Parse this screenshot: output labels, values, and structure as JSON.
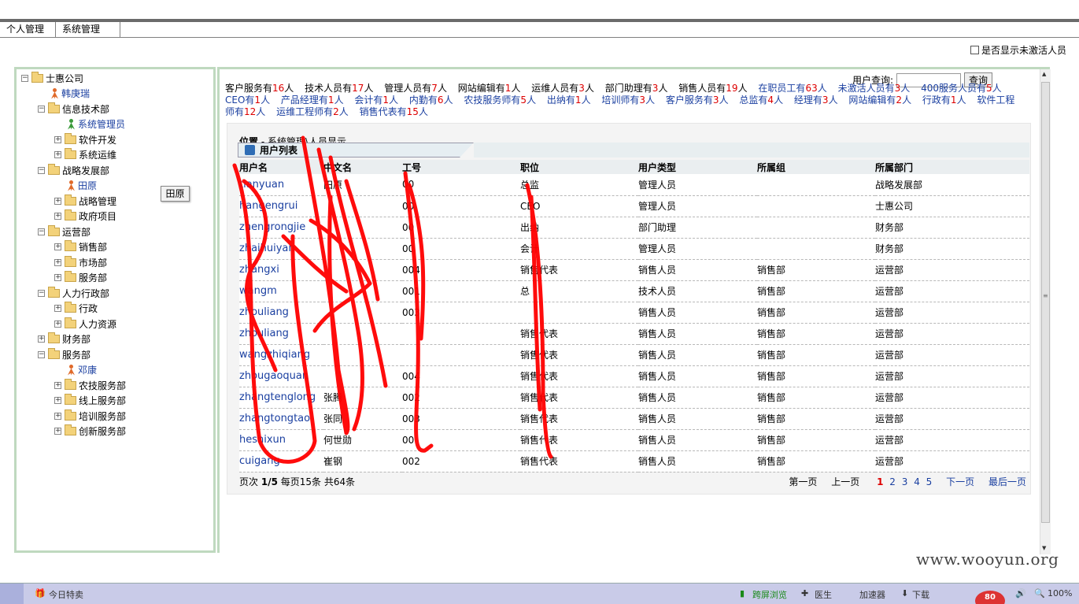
{
  "tabs": [
    "个人管理",
    "系统管理"
  ],
  "show_inactive_label": "是否显示未激活人员",
  "tree": [
    {
      "type": "root",
      "label": "士惠公司",
      "toggle": "⊟"
    },
    {
      "type": "person",
      "label": "韩庚瑞"
    },
    {
      "type": "folder",
      "label": "信息技术部",
      "toggle": "⊟"
    },
    {
      "type": "person-green",
      "label": "系统管理员"
    },
    {
      "type": "folder",
      "label": "软件开发",
      "toggle": "⊞"
    },
    {
      "type": "folder",
      "label": "系统运维",
      "toggle": "⊞"
    },
    {
      "type": "folder",
      "label": "战略发展部",
      "toggle": "⊟"
    },
    {
      "type": "person",
      "label": "田原"
    },
    {
      "type": "folder",
      "label": "战略管理",
      "toggle": "⊞"
    },
    {
      "type": "folder",
      "label": "政府项目",
      "toggle": "⊞"
    },
    {
      "type": "folder",
      "label": "运营部",
      "toggle": "⊟"
    },
    {
      "type": "folder",
      "label": "销售部",
      "toggle": "⊞"
    },
    {
      "type": "folder",
      "label": "市场部",
      "toggle": "⊞"
    },
    {
      "type": "folder",
      "label": "服务部",
      "toggle": "⊞"
    },
    {
      "type": "folder",
      "label": "人力行政部",
      "toggle": "⊟"
    },
    {
      "type": "folder",
      "label": "行政",
      "toggle": "⊞"
    },
    {
      "type": "folder",
      "label": "人力资源",
      "toggle": "⊞"
    },
    {
      "type": "folder",
      "label": "财务部",
      "toggle": "⊞"
    },
    {
      "type": "folder",
      "label": "服务部",
      "toggle": "⊟"
    },
    {
      "type": "person",
      "label": "邓康"
    },
    {
      "type": "folder",
      "label": "农技服务部",
      "toggle": "⊞"
    },
    {
      "type": "folder",
      "label": "线上服务部",
      "toggle": "⊞"
    },
    {
      "type": "folder",
      "label": "培训服务部",
      "toggle": "⊞"
    },
    {
      "type": "folder",
      "label": "创新服务部",
      "toggle": "⊞"
    }
  ],
  "tooltip": "田原",
  "query": {
    "label": "用户查询:",
    "button": "查询"
  },
  "stats": [
    {
      "pre": "客户服务有",
      "num": "16",
      "post": "人",
      "link": false
    },
    {
      "pre": "技术人员有",
      "num": "17",
      "post": "人",
      "link": false
    },
    {
      "pre": "管理人员有",
      "num": "7",
      "post": "人",
      "link": false
    },
    {
      "pre": "网站编辑有",
      "num": "1",
      "post": "人",
      "link": false
    },
    {
      "pre": "运维人员有",
      "num": "3",
      "post": "人",
      "link": false
    },
    {
      "pre": "部门助理有",
      "num": "3",
      "post": "人",
      "link": false
    },
    {
      "pre": "销售人员有",
      "num": "19",
      "post": "人",
      "link": false
    },
    {
      "pre": "在职员工有",
      "num": "63",
      "post": "人",
      "link": true
    },
    {
      "pre": "未激活人员有",
      "num": "3",
      "post": "人",
      "link": true
    },
    {
      "pre": "400服务人员有",
      "num": "5",
      "post": "人",
      "link": true
    },
    {
      "pre": "CEO有",
      "num": "1",
      "post": "人",
      "link": true
    },
    {
      "pre": "产品经理有",
      "num": "1",
      "post": "人",
      "link": true
    },
    {
      "pre": "会计有",
      "num": "1",
      "post": "人",
      "link": true
    },
    {
      "pre": "内勤有",
      "num": "6",
      "post": "人",
      "link": true
    },
    {
      "pre": "农技服务师有",
      "num": "5",
      "post": "人",
      "link": true
    },
    {
      "pre": "出纳有",
      "num": "1",
      "post": "人",
      "link": true
    },
    {
      "pre": "培训师有",
      "num": "3",
      "post": "人",
      "link": true
    },
    {
      "pre": "客户服务有",
      "num": "3",
      "post": "人",
      "link": true
    },
    {
      "pre": "总监有",
      "num": "4",
      "post": "人",
      "link": true
    },
    {
      "pre": "经理有",
      "num": "3",
      "post": "人",
      "link": true
    },
    {
      "pre": "网站编辑有",
      "num": "2",
      "post": "人",
      "link": true
    },
    {
      "pre": "行政有",
      "num": "1",
      "post": "人",
      "link": true
    },
    {
      "pre": "软件工程师有",
      "num": "12",
      "post": "人",
      "link": true
    },
    {
      "pre": "运维工程师有",
      "num": "2",
      "post": "人",
      "link": true
    },
    {
      "pre": "销售代表有",
      "num": "15",
      "post": "人",
      "link": true
    }
  ],
  "location": {
    "label": "位置",
    "path": "系统管理\\人员显示"
  },
  "list_title": "用户列表",
  "columns": [
    "用户名",
    "中文名",
    "工号",
    "职位",
    "用户类型",
    "所属组",
    "所属部门"
  ],
  "rows": [
    [
      "tianyuan",
      "田原",
      "00",
      "总监",
      "管理人员",
      "",
      "战略发展部"
    ],
    [
      "hangengrui",
      "",
      "00",
      "CEO",
      "管理人员",
      "",
      "士惠公司"
    ],
    [
      "zhengrongjie",
      "",
      "00",
      "出纳",
      "部门助理",
      "",
      "财务部"
    ],
    [
      "zhaihuiyan",
      "",
      "00",
      "会计",
      "管理人员",
      "",
      "财务部"
    ],
    [
      "zhangxi",
      "",
      "004",
      "销售代表",
      "销售人员",
      "销售部",
      "运营部"
    ],
    [
      "wangm",
      "",
      "001",
      "总",
      "技术人员",
      "销售部",
      "运营部"
    ],
    [
      "zhouliang",
      "",
      "003",
      "",
      "销售人员",
      "销售部",
      "运营部"
    ],
    [
      "zhouliang",
      "",
      "",
      "销售代表",
      "销售人员",
      "销售部",
      "运营部"
    ],
    [
      "wangzhiqiang",
      "",
      "",
      "销售代表",
      "销售人员",
      "销售部",
      "运营部"
    ],
    [
      "zhougaoquan",
      "",
      "004",
      "销售代表",
      "销售人员",
      "销售部",
      "运营部"
    ],
    [
      "zhangtenglong",
      "张腾",
      "002",
      "销售代表",
      "销售人员",
      "销售部",
      "运营部"
    ],
    [
      "zhangtongtao",
      "张同",
      "003",
      "销售代表",
      "销售人员",
      "销售部",
      "运营部"
    ],
    [
      "heshixun",
      "何世勋",
      "00",
      "销售代表",
      "销售人员",
      "销售部",
      "运营部"
    ],
    [
      "cuigang",
      "崔钢",
      "002",
      "销售代表",
      "销售人员",
      "销售部",
      "运营部"
    ]
  ],
  "pager": {
    "info_prefix": "页次",
    "info_page": "1/5",
    "info_mid": "每页15条 共64条",
    "first": "第一页",
    "prev": "上一页",
    "next": "下一页",
    "last": "最后一页",
    "pages": [
      "1",
      "2",
      "3",
      "4",
      "5"
    ]
  },
  "taskbar": {
    "today": "今日特卖",
    "browse": "跨屏浏览",
    "doctor": "医生",
    "accel": "加速器",
    "download": "下载",
    "zoom": "100%",
    "badge": "80"
  },
  "watermark": "www.wooyun.org"
}
